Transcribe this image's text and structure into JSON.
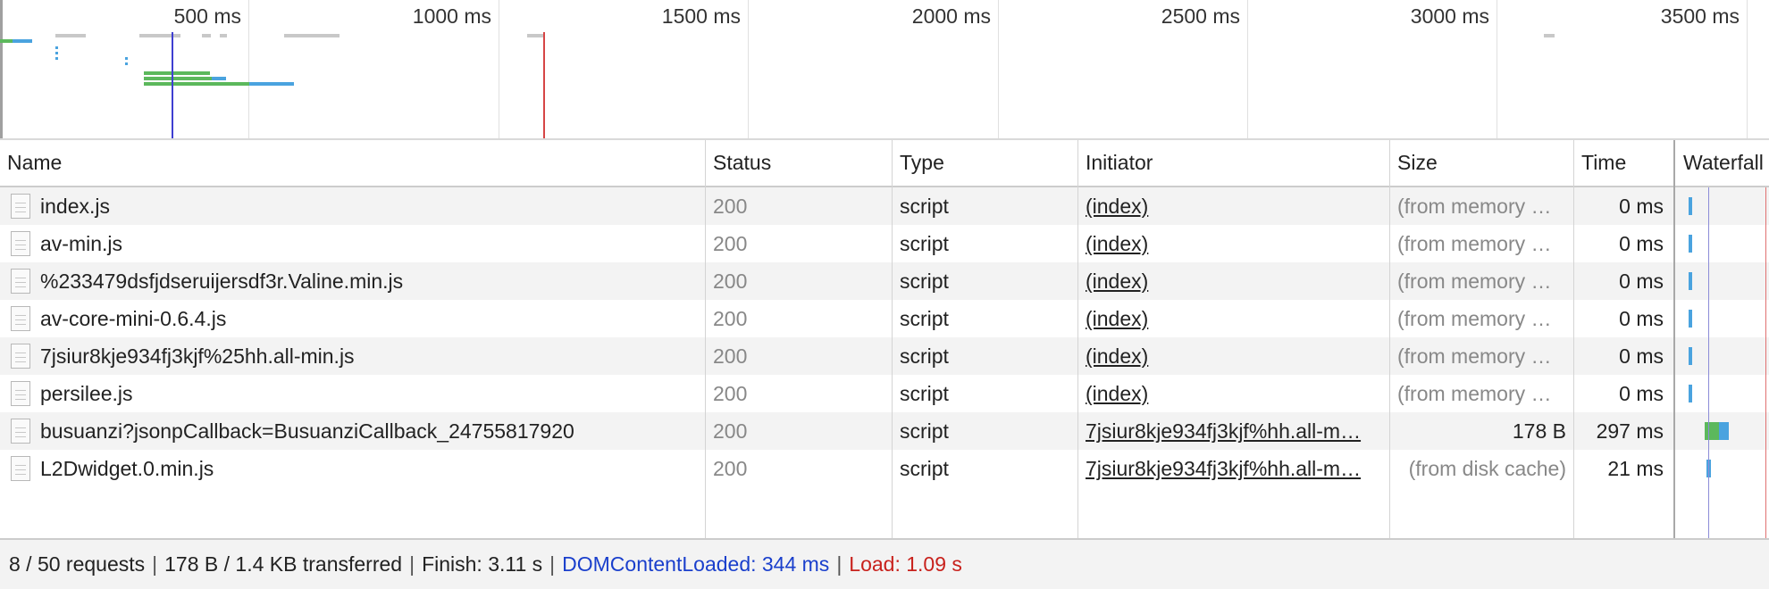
{
  "overview": {
    "ticks": [
      "500 ms",
      "1000 ms",
      "1500 ms",
      "2000 ms",
      "2500 ms",
      "3000 ms",
      "3500 ms"
    ]
  },
  "columns": {
    "name": "Name",
    "status": "Status",
    "type": "Type",
    "initiator": "Initiator",
    "size": "Size",
    "time": "Time",
    "waterfall": "Waterfall"
  },
  "requests": [
    {
      "name": "index.js",
      "status": "200",
      "type": "script",
      "initiator": "(index)",
      "size": "(from memory …",
      "time": "0 ms"
    },
    {
      "name": "av-min.js",
      "status": "200",
      "type": "script",
      "initiator": "(index)",
      "size": "(from memory …",
      "time": "0 ms"
    },
    {
      "name": "%233479dsfjdseruijersdf3r.Valine.min.js",
      "status": "200",
      "type": "script",
      "initiator": "(index)",
      "size": "(from memory …",
      "time": "0 ms"
    },
    {
      "name": "av-core-mini-0.6.4.js",
      "status": "200",
      "type": "script",
      "initiator": "(index)",
      "size": "(from memory …",
      "time": "0 ms"
    },
    {
      "name": "7jsiur8kje934fj3kjf%25hh.all-min.js",
      "status": "200",
      "type": "script",
      "initiator": "(index)",
      "size": "(from memory …",
      "time": "0 ms"
    },
    {
      "name": "persilee.js",
      "status": "200",
      "type": "script",
      "initiator": "(index)",
      "size": "(from memory …",
      "time": "0 ms"
    },
    {
      "name": "busuanzi?jsonpCallback=BusuanziCallback_24755817920",
      "status": "200",
      "type": "script",
      "initiator": "7jsiur8kje934fj3kjf%hh.all-m…",
      "size": "178 B",
      "time": "297 ms"
    },
    {
      "name": "L2Dwidget.0.min.js",
      "status": "200",
      "type": "script",
      "initiator": "7jsiur8kje934fj3kjf%hh.all-m…",
      "size": "(from disk cache)",
      "time": "21 ms"
    }
  ],
  "status_bar": {
    "requests": "8 / 50 requests",
    "transferred": "178 B / 1.4 KB transferred",
    "finish": "Finish: 3.11 s",
    "dom_content_loaded": "DOMContentLoaded: 344 ms",
    "load": "Load: 1.09 s"
  },
  "colors": {
    "waiting": "#5cb85c",
    "download": "#4aa3df",
    "queued": "#c8c8c8",
    "dom_content_loaded_line": "#3f3fd1",
    "load_line": "#d64545"
  }
}
